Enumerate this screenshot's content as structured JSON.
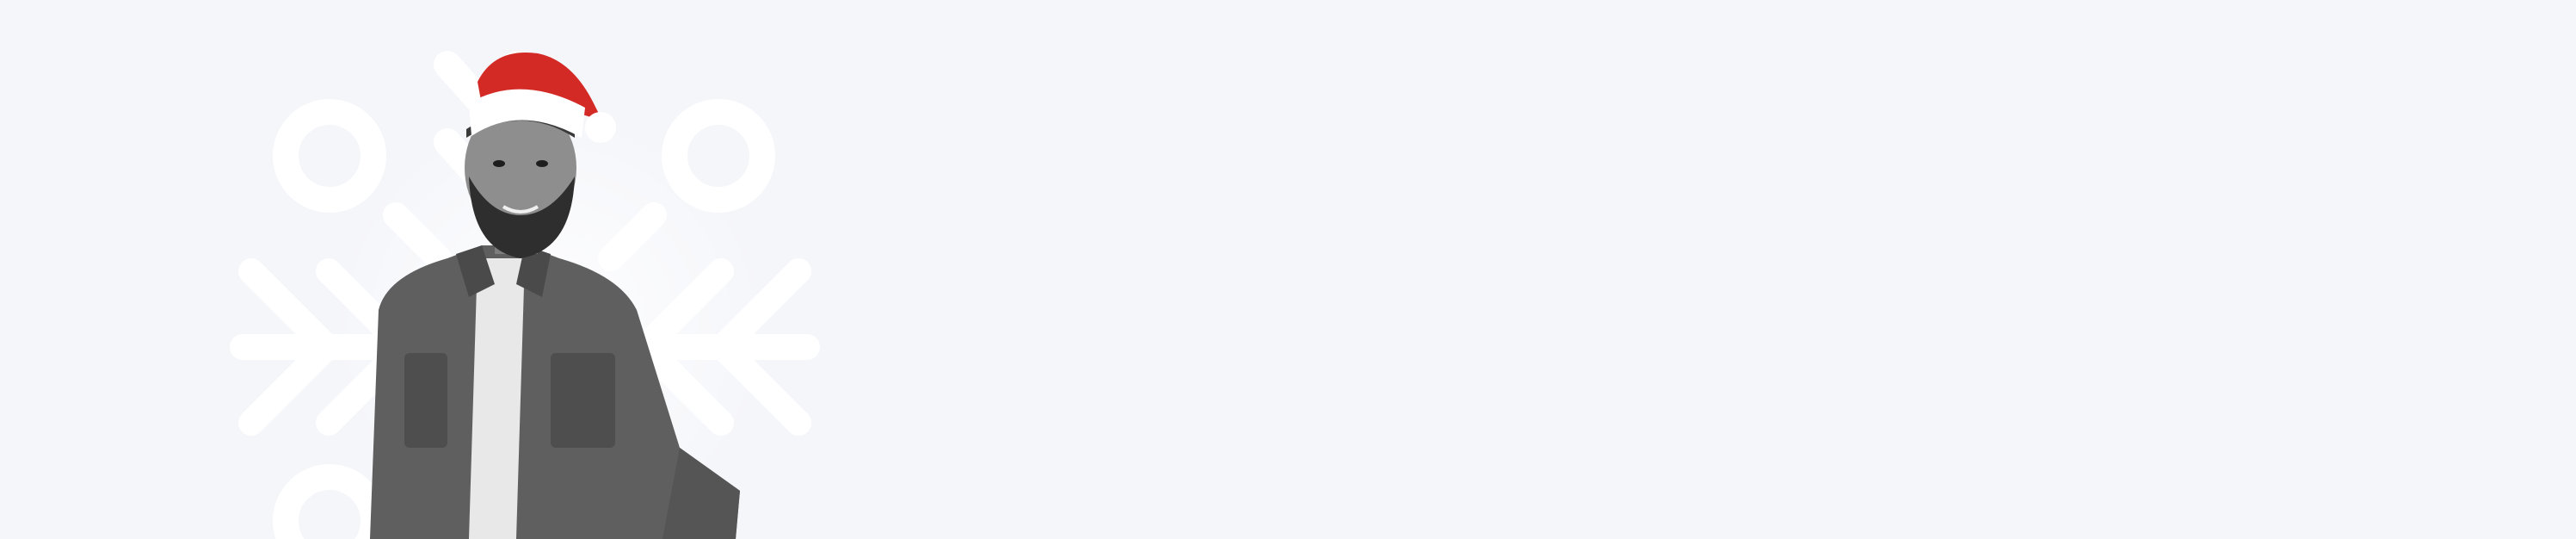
{
  "banner": {
    "background": "#f5f6fa",
    "decoration_color": "#ffffff",
    "hat_red": "#d42a26",
    "hat_trim": "#ffffff",
    "shirt_color": "#5c5c5c",
    "skin_tone": "#8a8a8a",
    "hero_image": "person-in-santa-hat-icon",
    "decoration": "snowflake-icon"
  }
}
